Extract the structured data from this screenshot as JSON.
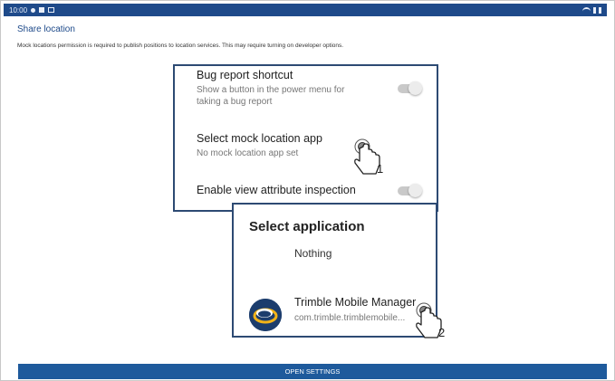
{
  "status_bar": {
    "time": "10:00",
    "left_icons": [
      "circle-dot-icon",
      "square-icon",
      "screenshot-icon"
    ],
    "right_icons": [
      "wifi-icon",
      "signal-icon",
      "battery-icon"
    ]
  },
  "page": {
    "title": "Share location",
    "description": "Mock locations permission is required to publish positions to location services. This may require turning on developer options."
  },
  "developer_options": {
    "bug_report": {
      "title": "Bug report shortcut",
      "subtitle_line1": "Show a button in the power menu for",
      "subtitle_line2": "taking a bug report",
      "enabled": false
    },
    "mock_location": {
      "title": "Select mock location app",
      "subtitle": "No mock location app set"
    },
    "view_attribute": {
      "title": "Enable view attribute inspection",
      "enabled": false
    }
  },
  "select_dialog": {
    "title": "Select application",
    "nothing_label": "Nothing",
    "app_name": "Trimble Mobile Manager",
    "app_package": "com.trimble.trimblemobile..."
  },
  "annotations": {
    "step1": "1",
    "step2": "2"
  },
  "bottom_button": {
    "label": "OPEN SETTINGS",
    "color": "#1e5a9c"
  }
}
